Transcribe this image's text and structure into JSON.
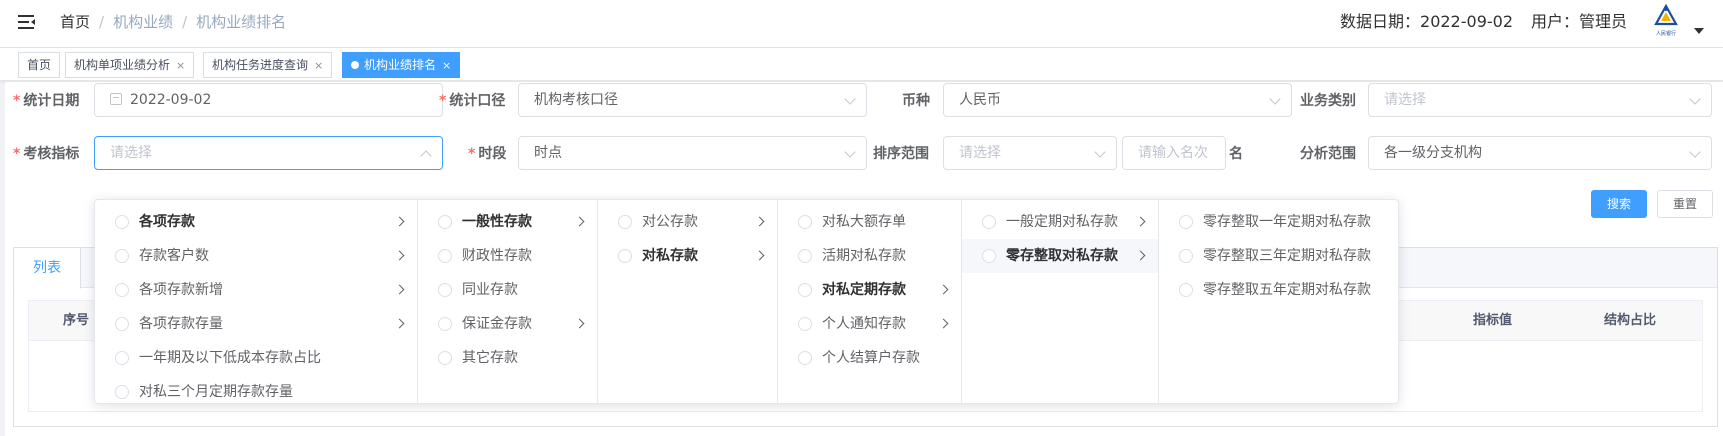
{
  "header": {
    "breadcrumb": [
      "首页",
      "机构业绩",
      "机构业绩排名"
    ],
    "data_date_label": "数据日期：",
    "data_date": "2022-09-02",
    "user_label": "用户：",
    "user_name": "管理员",
    "logo_caption": "人民银行"
  },
  "tags": [
    {
      "label": "首页",
      "closable": false,
      "active": false
    },
    {
      "label": "机构单项业绩分析",
      "closable": true,
      "active": false
    },
    {
      "label": "机构任务进度查询",
      "closable": true,
      "active": false
    },
    {
      "label": "机构业绩排名",
      "closable": true,
      "active": true
    }
  ],
  "form": {
    "stat_date": {
      "label": "统计日期",
      "value": "2022-09-02"
    },
    "stat_scope": {
      "label": "统计口径",
      "value": "机构考核口径"
    },
    "currency": {
      "label": "币种",
      "value": "人民币"
    },
    "biz_type": {
      "label": "业务类别",
      "placeholder": "请选择"
    },
    "indicator": {
      "label": "考核指标",
      "placeholder": "请选择"
    },
    "period": {
      "label": "时段",
      "value": "时点"
    },
    "rank_range": {
      "label": "排序范围",
      "placeholder": "请选择",
      "name_placeholder": "请输入名次",
      "suffix": "名"
    },
    "analysis_range": {
      "label": "分析范围",
      "value": "各一级分支机构"
    },
    "search_label": "搜索",
    "reset_label": "重置"
  },
  "tabs": {
    "active": "列表"
  },
  "table": {
    "headers": [
      "序号",
      "指标值",
      "结构占比"
    ]
  },
  "cascader": {
    "columns": [
      [
        {
          "label": "各项存款",
          "bold": true,
          "arrow": true
        },
        {
          "label": "存款客户数",
          "bold": false,
          "arrow": true
        },
        {
          "label": "各项存款新增",
          "bold": false,
          "arrow": true
        },
        {
          "label": "各项存款存量",
          "bold": false,
          "arrow": true
        },
        {
          "label": "一年期及以下低成本存款占比",
          "bold": false,
          "arrow": false
        },
        {
          "label": "对私三个月定期存款存量",
          "bold": false,
          "arrow": false
        }
      ],
      [
        {
          "label": "一般性存款",
          "bold": true,
          "arrow": true
        },
        {
          "label": "财政性存款",
          "bold": false,
          "arrow": false
        },
        {
          "label": "同业存款",
          "bold": false,
          "arrow": false
        },
        {
          "label": "保证金存款",
          "bold": false,
          "arrow": true
        },
        {
          "label": "其它存款",
          "bold": false,
          "arrow": false
        }
      ],
      [
        {
          "label": "对公存款",
          "bold": false,
          "arrow": true
        },
        {
          "label": "对私存款",
          "bold": true,
          "arrow": true
        }
      ],
      [
        {
          "label": "对私大额存单",
          "bold": false,
          "arrow": false
        },
        {
          "label": "活期对私存款",
          "bold": false,
          "arrow": false
        },
        {
          "label": "对私定期存款",
          "bold": true,
          "arrow": true
        },
        {
          "label": "个人通知存款",
          "bold": false,
          "arrow": true
        },
        {
          "label": "个人结算户存款",
          "bold": false,
          "arrow": false
        }
      ],
      [
        {
          "label": "一般定期对私存款",
          "bold": false,
          "arrow": true
        },
        {
          "label": "零存整取对私存款",
          "bold": true,
          "arrow": true,
          "selected": true
        }
      ],
      [
        {
          "label": "零存整取一年定期对私存款",
          "bold": false,
          "arrow": false
        },
        {
          "label": "零存整取三年定期对私存款",
          "bold": false,
          "arrow": false
        },
        {
          "label": "零存整取五年定期对私存款",
          "bold": false,
          "arrow": false
        }
      ]
    ]
  }
}
